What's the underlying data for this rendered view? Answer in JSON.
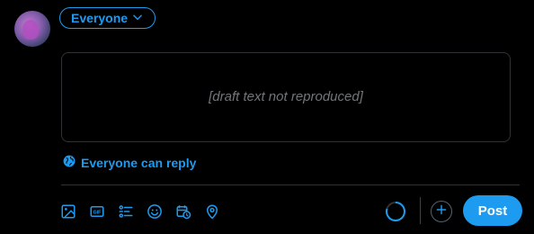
{
  "audience": {
    "label": "Everyone",
    "icon": "chevron-down-icon"
  },
  "composer": {
    "placeholder_note": "[draft text not reproduced]"
  },
  "reply_setting": {
    "label": "Everyone can reply",
    "icon": "globe-icon"
  },
  "toolbar": {
    "icons": [
      "image-icon",
      "gif-icon",
      "poll-icon",
      "emoji-icon",
      "schedule-icon",
      "location-icon"
    ]
  },
  "actions": {
    "post_label": "Post",
    "add_icon": "plus-icon"
  },
  "colors": {
    "accent": "#1d9bf0",
    "background": "#000000",
    "text": "#e7e9ea",
    "border": "#2f3336"
  }
}
